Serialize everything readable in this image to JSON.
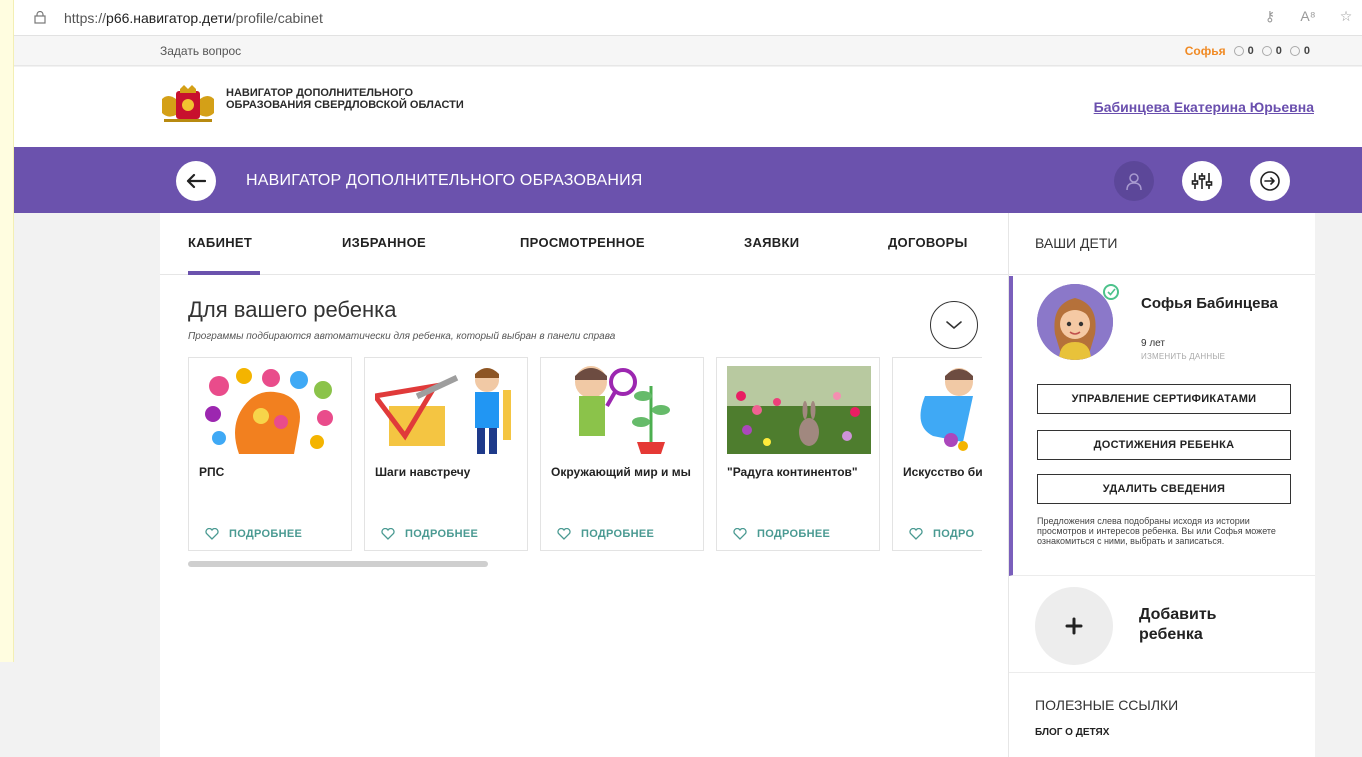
{
  "browser": {
    "url_prefix": "https://",
    "url_domain": "р66.навигатор.дети",
    "url_path": "/profile/cabinet"
  },
  "util": {
    "ask": "Задать вопрос",
    "child_name": "Софья",
    "stat1": "0",
    "stat2": "0",
    "stat3": "0"
  },
  "header": {
    "logo_text": "НАВИГАТОР ДОПОЛНИТЕЛЬНОГО ОБРАЗОВАНИЯ СВЕРДЛОВСКОЙ ОБЛАСТИ",
    "user_name": "Бабинцева Екатерина Юрьевна"
  },
  "nav": {
    "title": "НАВИГАТОР ДОПОЛНИТЕЛЬНОГО ОБРАЗОВАНИЯ"
  },
  "tabs": [
    {
      "label": "КАБИНЕТ",
      "active": true
    },
    {
      "label": "ИЗБРАННОЕ"
    },
    {
      "label": "ПРОСМОТРЕННОЕ"
    },
    {
      "label": "ЗАЯВКИ"
    },
    {
      "label": "ДОГОВОРЫ"
    }
  ],
  "section": {
    "title": "Для вашего ребенка",
    "subtitle": "Программы подбираются автоматически для ребенка, который выбран в панели справа"
  },
  "cards": [
    {
      "title": "РПС",
      "more": "ПОДРОБНЕЕ"
    },
    {
      "title": "Шаги навстречу",
      "more": "ПОДРОБНЕЕ"
    },
    {
      "title": "Окружающий мир и мы",
      "more": "ПОДРОБНЕЕ"
    },
    {
      "title": "\"Радуга континентов\"",
      "more": "ПОДРОБНЕЕ"
    },
    {
      "title": "Искусство бисероплет",
      "more": "ПОДРО"
    }
  ],
  "sidebar": {
    "header": "ВАШИ ДЕТИ",
    "child": {
      "name": "Софья Бабинцева",
      "age": "9 лет",
      "edit": "ИЗМЕНИТЬ ДАННЫЕ"
    },
    "buttons": {
      "certificates": "УПРАВЛЕНИЕ СЕРТИФИКАТАМИ",
      "achievements": "ДОСТИЖЕНИЯ РЕБЕНКА",
      "delete": "УДАЛИТЬ СВЕДЕНИЯ"
    },
    "note": "Предложения слева подобраны исходя из истории просмотров и интересов ребенка. Вы или Софья можете ознакомиться с ними, выбрать и записаться.",
    "add_child": "Добавить ребенка",
    "links_title": "ПОЛЕЗНЫЕ ССЫЛКИ",
    "link_blog": "БЛОГ О ДЕТЯХ"
  },
  "colors": {
    "brand": "#6b52ad",
    "accent_orange": "#f08a24",
    "link_teal": "#4a9a92"
  }
}
